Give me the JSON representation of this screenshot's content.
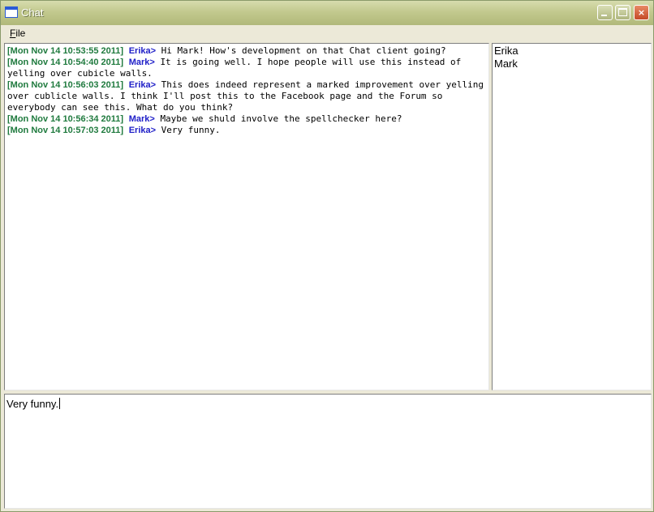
{
  "window": {
    "title": "Chat",
    "icon": "window-icon",
    "buttons": {
      "minimize": "minimize-icon",
      "maximize": "maximize-icon",
      "close": "×"
    }
  },
  "menu": {
    "file_mnemonic": "F",
    "file_rest": "ile"
  },
  "colors": {
    "timestamp": "#1f7a3e",
    "nick": "#2020c8",
    "titlebar": "#c2c98e"
  },
  "messages": [
    {
      "ts": "[Mon Nov 14 10:53:55 2011]",
      "nick": "Erika>",
      "text": "Hi Mark! How's development on that Chat client going?"
    },
    {
      "ts": "[Mon Nov 14 10:54:40 2011]",
      "nick": "Mark>",
      "text": "It is going well. I hope people will use this instead of yelling over cubicle walls."
    },
    {
      "ts": "[Mon Nov 14 10:56:03 2011]",
      "nick": "Erika>",
      "text": "This does indeed represent a marked improvement over yelling over cublicle walls. I think I'll post this to the Facebook page and the Forum so everybody can see this. What do you think?"
    },
    {
      "ts": "[Mon Nov 14 10:56:34 2011]",
      "nick": "Mark>",
      "text": "Maybe we shuld involve the spellchecker here?"
    },
    {
      "ts": "[Mon Nov 14 10:57:03 2011]",
      "nick": "Erika>",
      "text": "Very funny."
    }
  ],
  "users": [
    "Erika",
    "Mark"
  ],
  "input": {
    "value": "Very funny."
  }
}
